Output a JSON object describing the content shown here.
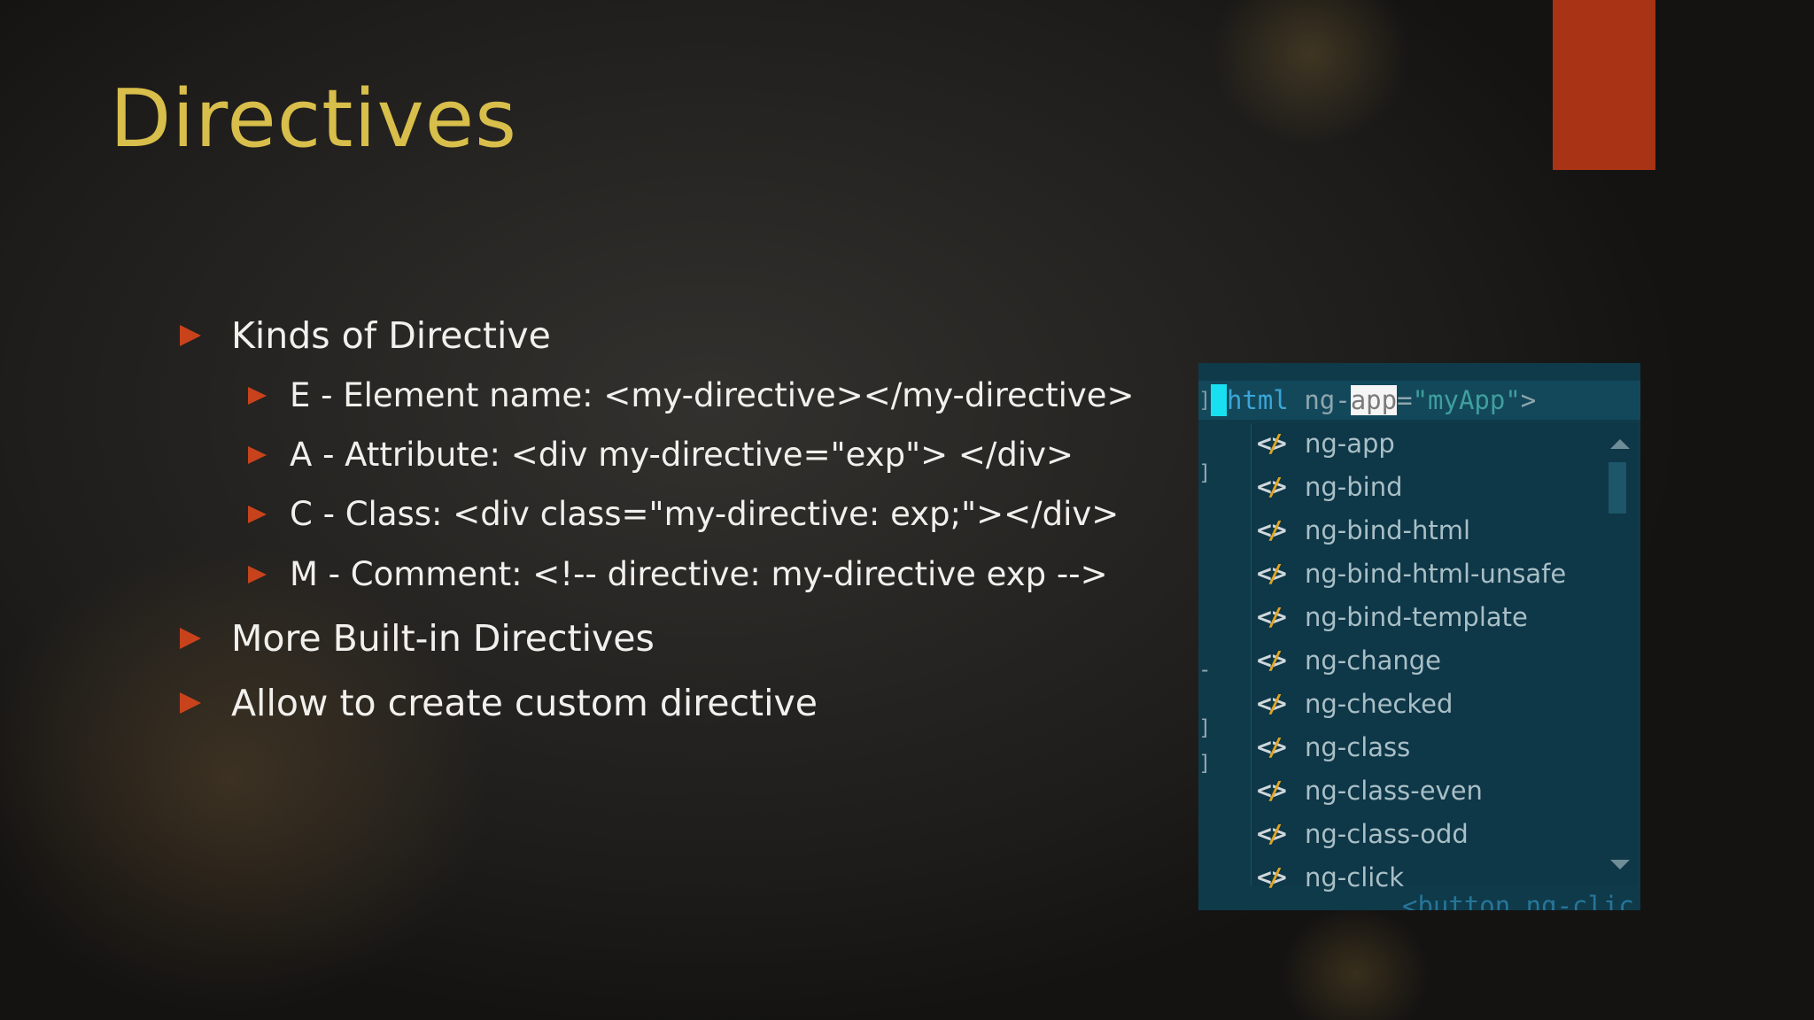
{
  "slide": {
    "title": "Directives",
    "accent_color": "#a83315",
    "title_color": "#d8be4a",
    "bullets": [
      {
        "level": 1,
        "text": "Kinds of Directive"
      },
      {
        "level": 2,
        "text": "E - Element name: <my-directive></my-directive>"
      },
      {
        "level": 2,
        "text": "A - Attribute: <div my-directive=\"exp\"> </div>"
      },
      {
        "level": 2,
        "text": "C - Class: <div class=\"my-directive: exp;\"></div>"
      },
      {
        "level": 2,
        "text": "M - Comment: <!-- directive: my-directive exp -->"
      },
      {
        "level": 1,
        "text": "More Built-in Directives"
      },
      {
        "level": 1,
        "text": "Allow to create custom directive"
      }
    ]
  },
  "editor": {
    "code_line": {
      "gutter": "]",
      "tag": "html",
      "attr_prefix": "ng-",
      "attr_highlight": "app",
      "equals": "=",
      "value": "\"myApp\"",
      "close": ">"
    },
    "gutter_marks": [
      "]",
      "-",
      "]",
      "]"
    ],
    "completion_items": [
      "ng-app",
      "ng-bind",
      "ng-bind-html",
      "ng-bind-html-unsafe",
      "ng-bind-template",
      "ng-change",
      "ng-checked",
      "ng-class",
      "ng-class-even",
      "ng-class-odd",
      "ng-click"
    ],
    "item_icon": "angular-directive-icon",
    "next_line_partial": "<button ng-clic"
  }
}
